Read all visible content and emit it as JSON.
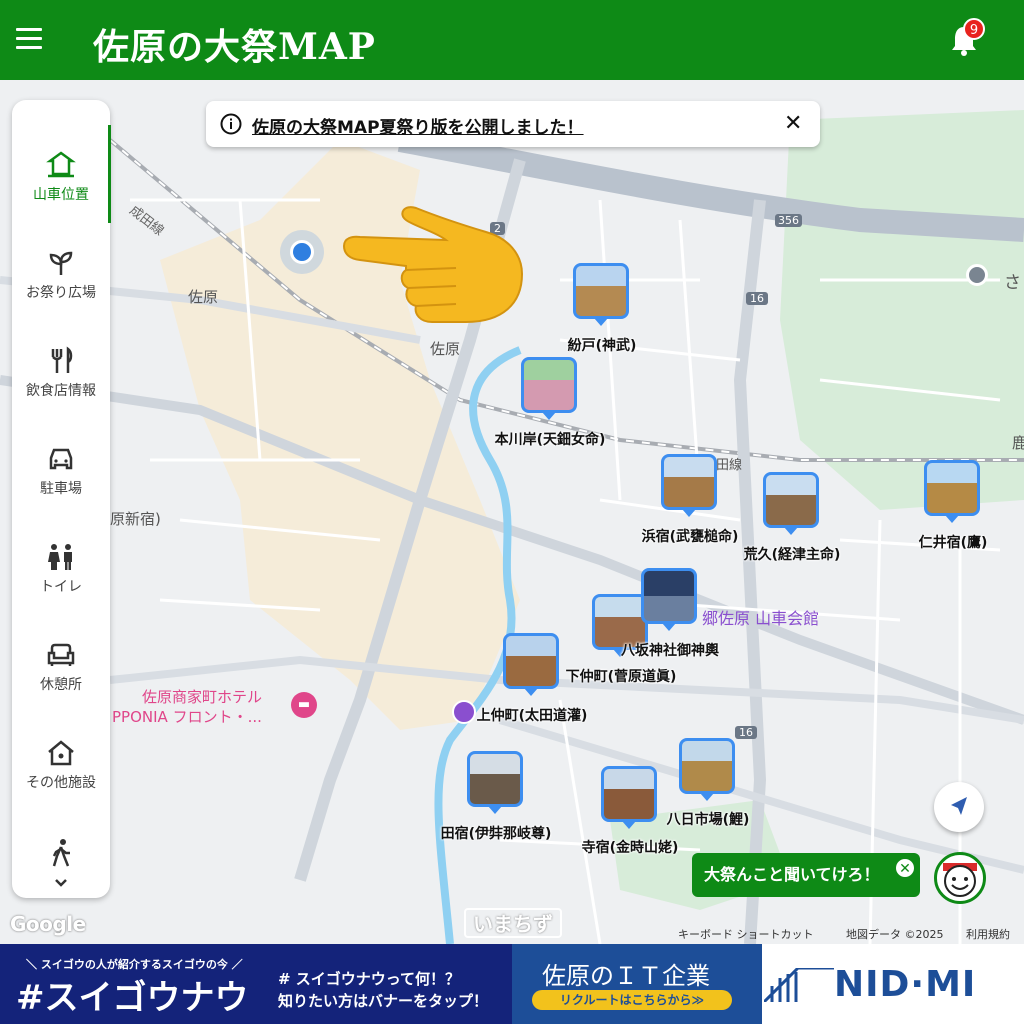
{
  "header": {
    "title": "佐原の大祭MAP",
    "notification_count": "9"
  },
  "notice": {
    "text": "佐原の大祭MAP夏祭り版を公開しました！"
  },
  "sidebar": {
    "items": [
      {
        "label": "山車位置"
      },
      {
        "label": "お祭り広場"
      },
      {
        "label": "飲食店情報"
      },
      {
        "label": "駐車場"
      },
      {
        "label": "トイレ"
      },
      {
        "label": "休憩所"
      },
      {
        "label": "その他施設"
      }
    ]
  },
  "floats": [
    {
      "label": "紛戸(神武)"
    },
    {
      "label": "本川岸(天鈿女命)"
    },
    {
      "label": "浜宿(武甕槌命)"
    },
    {
      "label": "荒久(経津主命)"
    },
    {
      "label": "仁井宿(鷹)"
    },
    {
      "label": "八坂神社御神輿"
    },
    {
      "label": "下仲町(菅原道眞)"
    },
    {
      "label": "上仲町(太田道灌)"
    },
    {
      "label": "田宿(伊弉那岐尊)"
    },
    {
      "label": "寺宿(金時山姥)"
    },
    {
      "label": "八日市場(鯉)"
    }
  ],
  "map_labels": {
    "station": "佐原",
    "town": "佐原",
    "narita_line": "成田線",
    "line2": "田線",
    "shinjuku": "原新宿)",
    "kashima": "鹿",
    "sa": "さ",
    "hall": "郷佐原 山車会館",
    "hotel_line1": "佐原商家町ホテル",
    "hotel_line2": "PPONIA フロント・...",
    "route_356": "356",
    "route_16a": "16",
    "route_16b": "16",
    "route_2": "2"
  },
  "chat": {
    "text": "大祭んこと聞いてけろ！"
  },
  "map_footer": {
    "shortcuts": "キーボード ショートカット",
    "data": "地図データ ©2025",
    "terms": "利用規約",
    "google": "Google",
    "watermark": "いまちず"
  },
  "banners": {
    "left_top": "＼ スイゴウの人が紹介するスイゴウの今 ／",
    "left_main": "#スイゴウナウ",
    "left_line1": "# スイゴウナウって何！？",
    "left_line2": "知りたい方はバナーをタップ！",
    "right_title": "佐原のＩＴ企業",
    "right_sub": "リクルートはこちらから≫",
    "right_logo": "NID·MI"
  },
  "colors": {
    "header": "#0e8a16",
    "accent": "#3d8ef0",
    "badge": "#e8231e"
  },
  "icons": [
    "menu-icon",
    "bell-icon",
    "info-icon",
    "close-icon",
    "shrine-icon",
    "sprout-icon",
    "fork-knife-icon",
    "car-icon",
    "toilet-icon",
    "sofa-icon",
    "house-icon",
    "walker-icon",
    "navigation-icon",
    "pointing-hand-icon"
  ]
}
